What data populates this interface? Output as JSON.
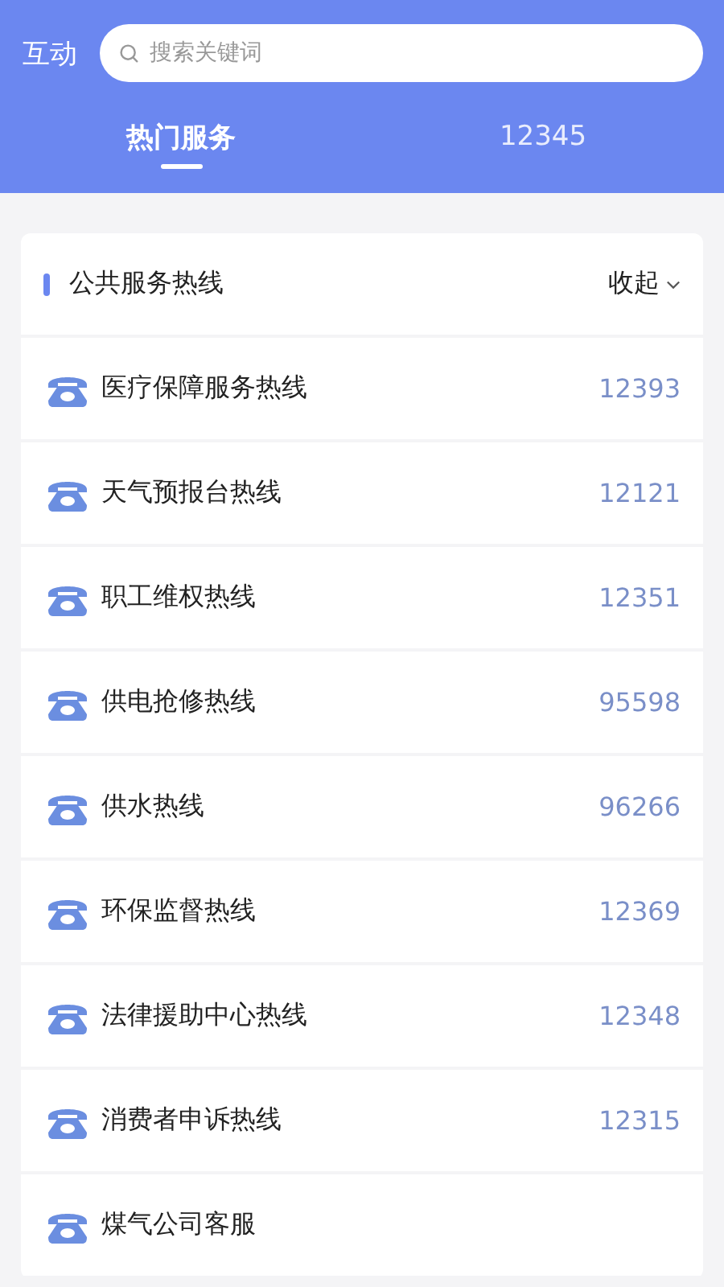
{
  "header": {
    "title": "互动",
    "search": {
      "placeholder": "搜索关键词"
    }
  },
  "tabs": [
    {
      "label": "热门服务",
      "selected": true
    },
    {
      "label": "12345",
      "selected": false
    }
  ],
  "section": {
    "title": "公共服务热线",
    "toggle": "收起",
    "expanded": true,
    "rows": [
      {
        "name": "医疗保障服务热线",
        "number": "12393"
      },
      {
        "name": "天气预报台热线",
        "number": "12121"
      },
      {
        "name": "职工维权热线",
        "number": "12351"
      },
      {
        "name": "供电抢修热线",
        "number": "95598"
      },
      {
        "name": "供水热线",
        "number": "96266"
      },
      {
        "name": "环保监督热线",
        "number": "12369"
      },
      {
        "name": "法律援助中心热线",
        "number": "12348"
      },
      {
        "name": "消费者申诉热线",
        "number": "12315"
      },
      {
        "name": "煤气公司客服"
      }
    ]
  }
}
